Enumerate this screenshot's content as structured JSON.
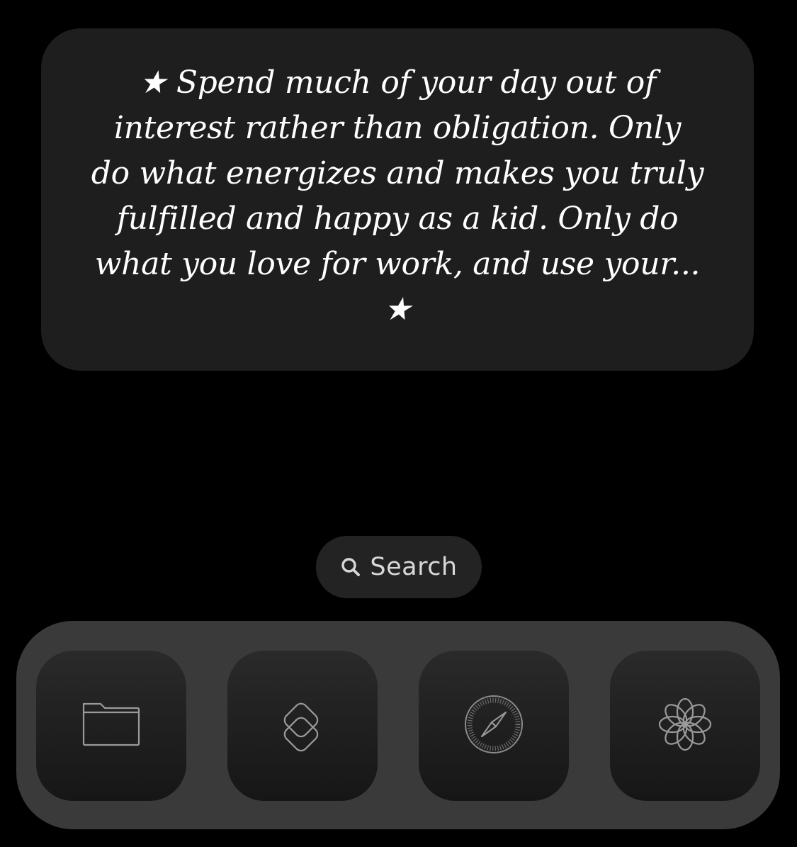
{
  "quote_widget": {
    "text": "★ Spend much of your day out of interest rather than obligation. Only do what energizes and makes you truly fulfilled and happy as a kid. Only do what you love for work, and use your... ★"
  },
  "search": {
    "label": "Search",
    "icon": "magnifier-icon"
  },
  "dock": {
    "apps": [
      {
        "icon": "folder-icon"
      },
      {
        "icon": "shortcuts-icon"
      },
      {
        "icon": "compass-icon"
      },
      {
        "icon": "flower-icon"
      }
    ]
  },
  "colors": {
    "background": "#000000",
    "widget": "#1e1e1e",
    "dock": "#3a3a3a",
    "icon_stroke": "#9a9a9a"
  }
}
